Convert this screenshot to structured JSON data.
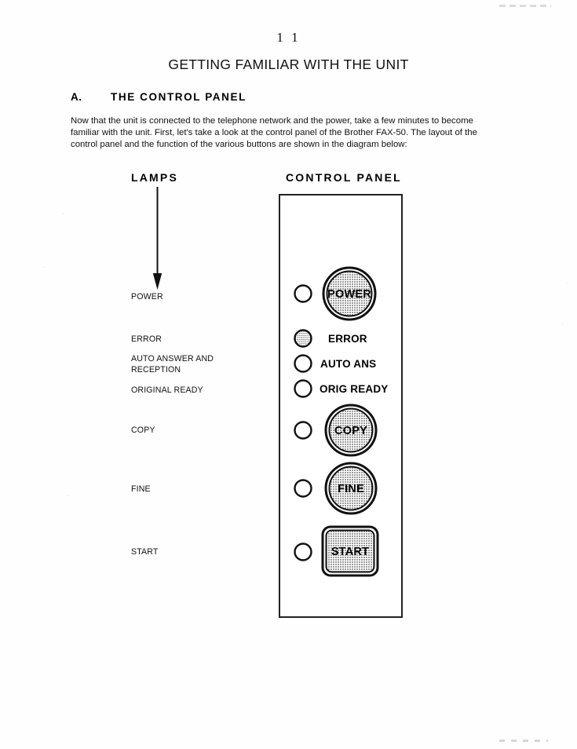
{
  "document": {
    "page_number": "1 1",
    "title": "GETTING FAMILIAR WITH THE UNIT",
    "section": {
      "letter": "A.",
      "title": "THE  CONTROL  PANEL"
    },
    "body": "Now that the unit is connected to the telephone network and the power, take a few minutes to become familiar with the unit.  First, let's take a look at the control panel of the Brother FAX-50.  The layout of the control panel and the function of the various buttons are shown in the diagram below:"
  },
  "diagram": {
    "lamps_heading": "LAMPS",
    "panel_heading": "CONTROL  PANEL",
    "arrow_icon": "down-arrow-icon",
    "lamp_labels": [
      {
        "id": "power",
        "text": "POWER"
      },
      {
        "id": "error",
        "text": "ERROR"
      },
      {
        "id": "auto-answer-and-reception",
        "text": "AUTO ANSWER AND\nRECEPTION"
      },
      {
        "id": "original-ready",
        "text": "ORIGINAL READY"
      },
      {
        "id": "copy",
        "text": "COPY"
      },
      {
        "id": "fine",
        "text": "FINE"
      },
      {
        "id": "start",
        "text": "START"
      }
    ],
    "panel": {
      "indicator_lamps": [
        {
          "id": "power",
          "lit": false
        },
        {
          "id": "error",
          "lit": true
        },
        {
          "id": "auto-ans",
          "lit": false
        },
        {
          "id": "orig-ready",
          "lit": false
        },
        {
          "id": "copy",
          "lit": false
        },
        {
          "id": "fine",
          "lit": false
        },
        {
          "id": "start",
          "lit": false
        }
      ],
      "inline_labels": {
        "error": "ERROR",
        "auto_ans": "AUTO ANS",
        "orig_ready": "ORIG READY"
      },
      "buttons": [
        {
          "id": "power",
          "label": "POWER",
          "shape": "circle"
        },
        {
          "id": "copy",
          "label": "COPY",
          "shape": "circle"
        },
        {
          "id": "fine",
          "label": "FINE",
          "shape": "circle"
        },
        {
          "id": "start",
          "label": "START",
          "shape": "rounded-square"
        }
      ]
    }
  },
  "colors": {
    "ink": "#111111",
    "paper": "#fefefe",
    "button_fill": "#d0d0d0",
    "outline": "#222222"
  }
}
